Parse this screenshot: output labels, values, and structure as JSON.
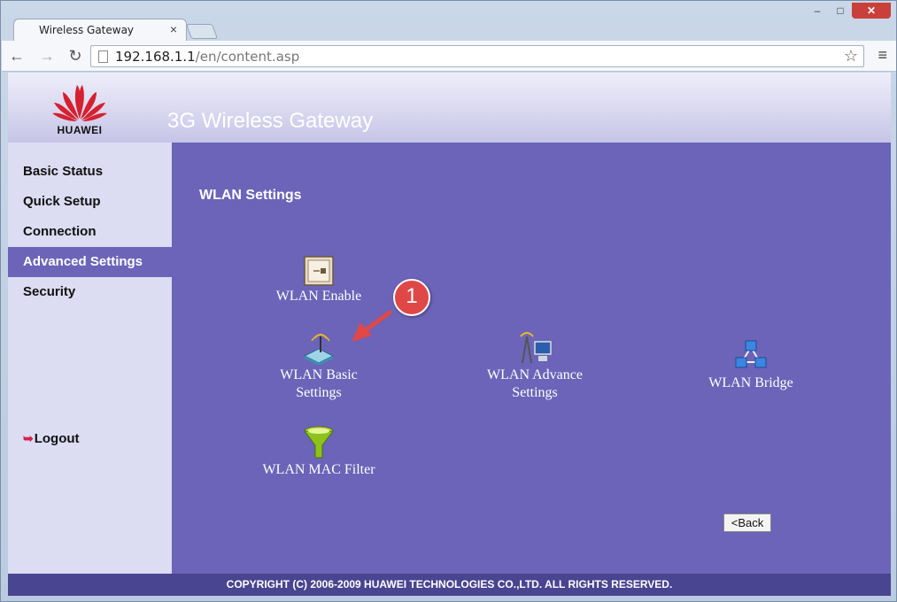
{
  "browser": {
    "tab_title": "Wireless Gateway",
    "tab_close": "×",
    "url_host": "192.168.1.1",
    "url_path": "/en/content.asp",
    "window_controls": {
      "minimize": "–",
      "maximize": "□",
      "close": "✕"
    }
  },
  "header": {
    "logo_text": "HUAWEI",
    "title": "3G Wireless Gateway"
  },
  "sidebar": {
    "items": [
      {
        "label": "Basic Status",
        "active": false
      },
      {
        "label": "Quick Setup",
        "active": false
      },
      {
        "label": "Connection",
        "active": false
      },
      {
        "label": "Advanced Settings",
        "active": true
      },
      {
        "label": "Security",
        "active": false
      }
    ],
    "logout": "Logout"
  },
  "main": {
    "section_title": "WLAN Settings",
    "tiles": [
      {
        "label": "WLAN Enable",
        "icon": "switch-icon"
      },
      {
        "label": "WLAN Basic\nSettings",
        "icon": "wireless-router-icon"
      },
      {
        "label": "WLAN Advance\nSettings",
        "icon": "antenna-computer-icon"
      },
      {
        "label": "WLAN Bridge",
        "icon": "network-bridge-icon"
      },
      {
        "label": "WLAN MAC Filter",
        "icon": "funnel-filter-icon"
      }
    ],
    "back_button": "<Back"
  },
  "annotation": {
    "number": "1"
  },
  "footer": {
    "copyright": "COPYRIGHT (C) 2006-2009 HUAWEI TECHNOLOGIES CO.,LTD. ALL RIGHTS RESERVED."
  },
  "colors": {
    "content_bg": "#6b64b8",
    "sidebar_bg": "#dcdcf2",
    "footer_bg": "#4a4590",
    "annotation_red": "#e04848",
    "logo_red": "#d6202f"
  }
}
